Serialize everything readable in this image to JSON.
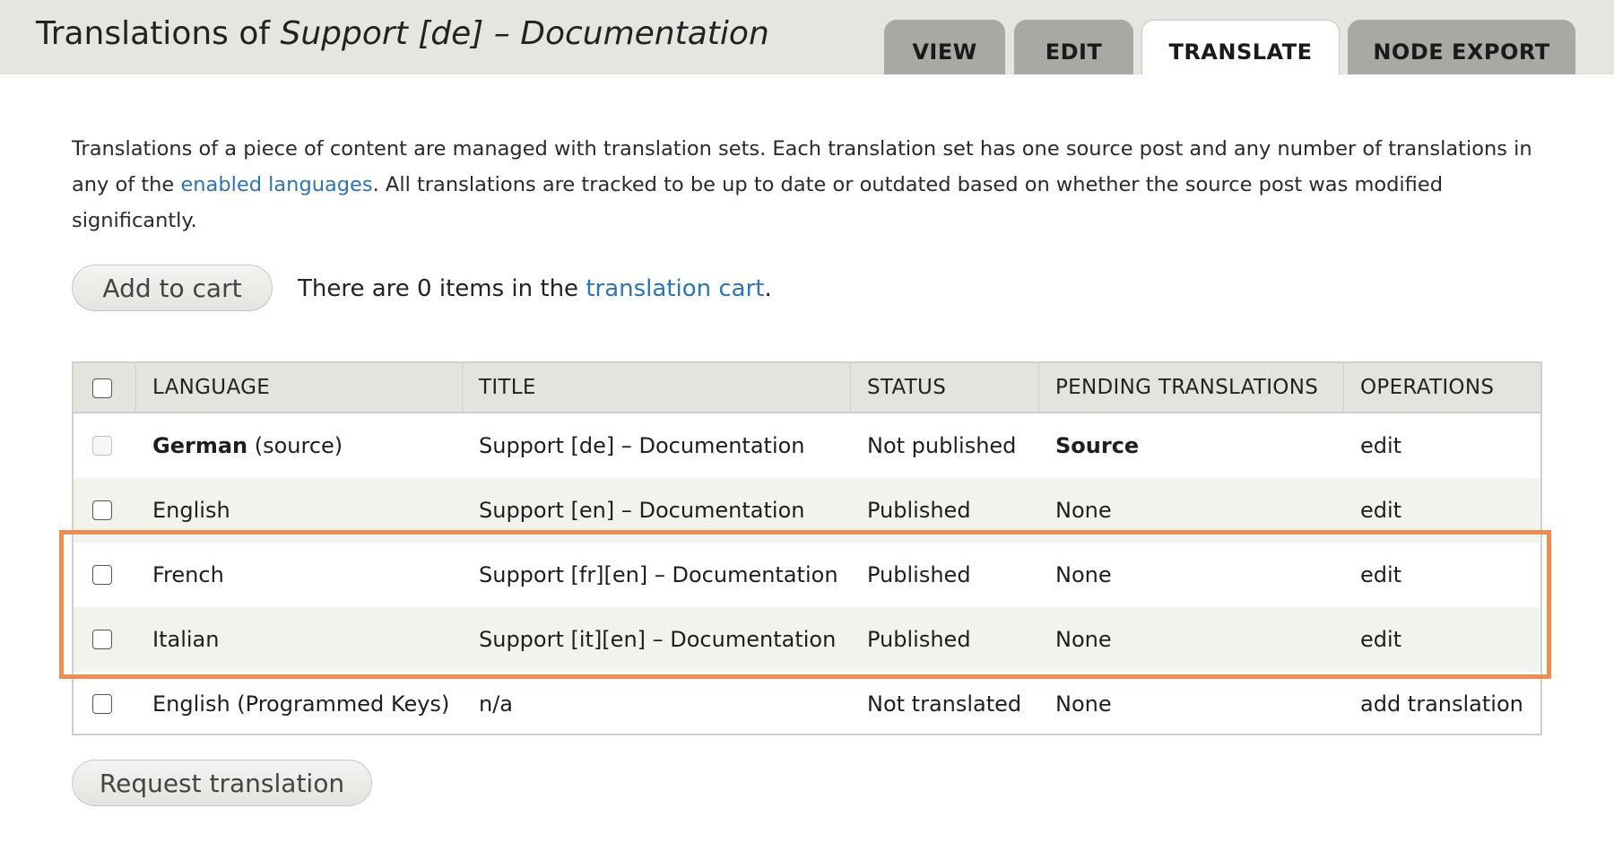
{
  "header": {
    "title_prefix": "Translations of ",
    "title_node": "Support [de] – Documentation",
    "tabs": [
      {
        "label": "VIEW",
        "active": false
      },
      {
        "label": "EDIT",
        "active": false
      },
      {
        "label": "TRANSLATE",
        "active": true
      },
      {
        "label": "NODE EXPORT",
        "active": false
      }
    ]
  },
  "intro": {
    "text_1": "Translations of a piece of content are managed with translation sets. Each translation set has one source post and any number of translations in any of the ",
    "link": "enabled languages",
    "text_2": ". All translations are tracked to be up to date or outdated based on whether the source post was modified significantly."
  },
  "cart": {
    "button_label": "Add to cart",
    "text_prefix": "There are 0 items in the ",
    "link": "translation cart",
    "text_suffix": "."
  },
  "table": {
    "columns": [
      "LANGUAGE",
      "TITLE",
      "STATUS",
      "PENDING TRANSLATIONS",
      "OPERATIONS"
    ],
    "rows": [
      {
        "language": "German",
        "language_note": " (source)",
        "title": "Support [de] – Documentation",
        "title_is_link": true,
        "status": "Not published",
        "pending": "Source",
        "pending_bold": true,
        "operation": "edit",
        "checkbox_disabled": true
      },
      {
        "language": "English",
        "language_note": "",
        "title": "Support [en] – Documentation",
        "title_is_link": true,
        "status": "Published",
        "pending": "None",
        "pending_bold": false,
        "operation": "edit",
        "checkbox_disabled": false
      },
      {
        "language": "French",
        "language_note": "",
        "title": "Support [fr][en] – Documentation",
        "title_is_link": true,
        "status": "Published",
        "pending": "None",
        "pending_bold": false,
        "operation": "edit",
        "checkbox_disabled": false
      },
      {
        "language": "Italian",
        "language_note": "",
        "title": "Support [it][en] – Documentation",
        "title_is_link": true,
        "status": "Published",
        "pending": "None",
        "pending_bold": false,
        "operation": "edit",
        "checkbox_disabled": false
      },
      {
        "language": "English (Programmed Keys)",
        "language_note": "",
        "title": "n/a",
        "title_is_link": false,
        "status": "Not translated",
        "pending": "None",
        "pending_bold": false,
        "operation": "add translation",
        "checkbox_disabled": false
      }
    ]
  },
  "request_button_label": "Request translation",
  "colors": {
    "link": "#2b74b5",
    "highlight_border": "#ee8d52",
    "header_bg": "#e6e5df",
    "tab_bg": "#a8a8a4"
  }
}
